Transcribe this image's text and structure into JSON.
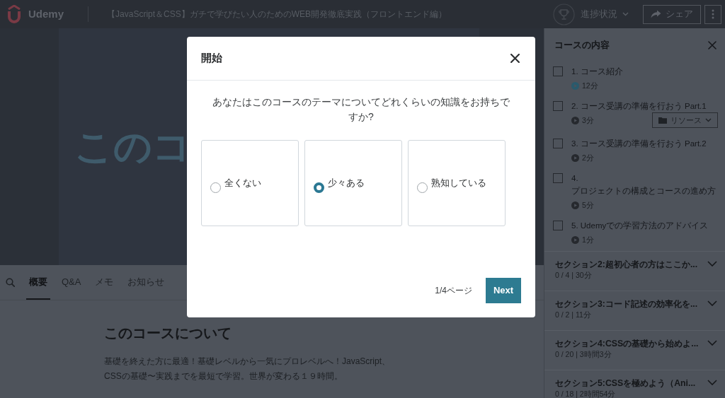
{
  "top_bar": {
    "logo_text": "Udemy",
    "course_title": "【JavaScript＆CSS】ガチで学びたい人のためのWEB開発徹底実践（フロントエンド編）",
    "progress_label": "進捗状況",
    "share_label": "シェア"
  },
  "video": {
    "slide_text": "このコ"
  },
  "tabs": [
    {
      "label": "概要",
      "selected": true
    },
    {
      "label": "Q&A",
      "selected": false
    },
    {
      "label": "メモ",
      "selected": false
    },
    {
      "label": "お知らせ",
      "selected": false
    }
  ],
  "about": {
    "title": "このコースについて",
    "description": "基礎を終えた方に最適！基礎レベルから一気にプロレベルへ！JavaScript、CSSの基礎〜実践までを最短で学習。世界が変わる１９時間。"
  },
  "sidebar": {
    "title": "コースの内容",
    "lectures": [
      {
        "number": "1.",
        "title": "コース紹介",
        "duration": "12分",
        "completed": false,
        "current": true
      },
      {
        "number": "2.",
        "title": "コース受講の準備を行おう Part.1",
        "duration": "3分",
        "completed": false,
        "current": false,
        "resources_label": "リソース"
      },
      {
        "number": "3.",
        "title": "コース受講の準備を行おう Part.2",
        "duration": "2分",
        "completed": false,
        "current": false
      },
      {
        "number": "4.",
        "title": "プロジェクトの構成とコースの進め方",
        "duration": "5分",
        "completed": false,
        "current": false
      },
      {
        "number": "5.",
        "title": "Udemyでの学習方法のアドバイス",
        "duration": "1分",
        "completed": false,
        "current": false
      }
    ],
    "sections": [
      {
        "title": "セクション2:超初心者の方はここか...",
        "summary": "0 / 4 | 30分",
        "expanded": false
      },
      {
        "title": "セクション3:コード記述の効率化を...",
        "summary": "0 / 2 | 11分",
        "expanded": false
      },
      {
        "title": "セクション4:CSSの基礎から始めよ...",
        "summary": "0 / 20 | 3時間3分",
        "expanded": false
      },
      {
        "title": "セクション5:CSSを極めよう（Ani...",
        "summary": "0 / 18 | 2時間54分",
        "expanded": false
      }
    ]
  },
  "modal": {
    "title": "開始",
    "question": "あなたはこのコースのテーマについてどれくらいの知識をお持ちですか?",
    "options": [
      {
        "label": "全くない",
        "selected": false
      },
      {
        "label": "少々ある",
        "selected": true
      },
      {
        "label": "熟知している",
        "selected": false
      }
    ],
    "page_indicator": "1/4ページ",
    "next_label": "Next"
  }
}
